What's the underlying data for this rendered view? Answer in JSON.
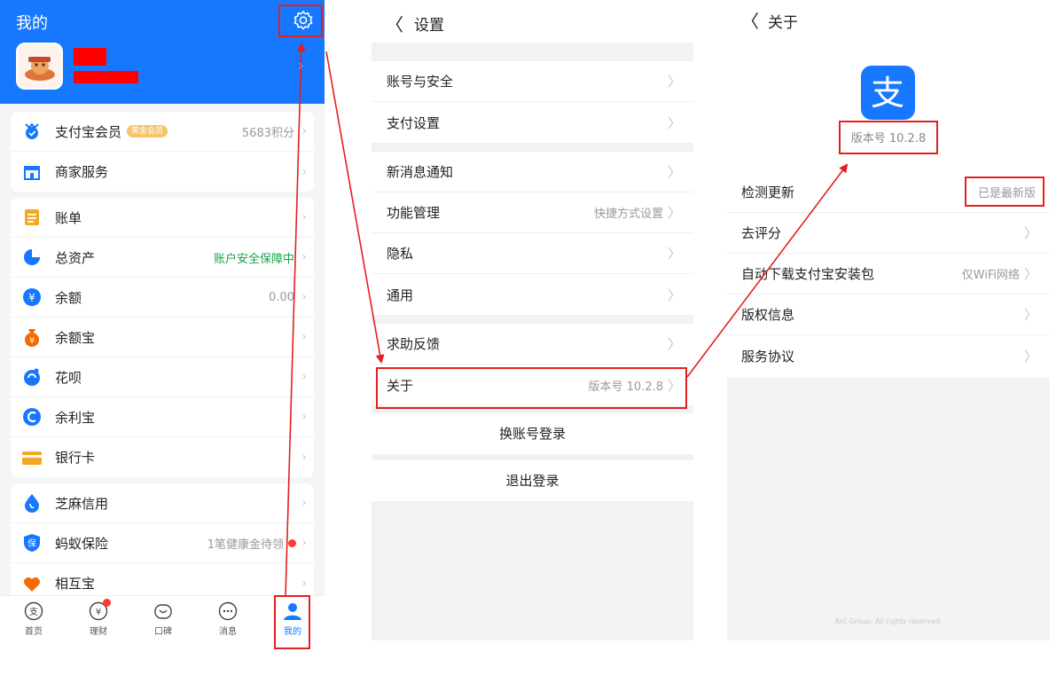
{
  "panel_mine": {
    "title": "我的",
    "items_group1": [
      {
        "label": "支付宝会员",
        "badge": "黄金会员",
        "value": "5683积分",
        "icon": "member-icon",
        "color": "#1677ff"
      },
      {
        "label": "商家服务",
        "value": "",
        "icon": "shop-icon",
        "color": "#1677ff"
      }
    ],
    "items_group2": [
      {
        "label": "账单",
        "value": "",
        "icon": "bill-icon",
        "color": "#f5a623"
      },
      {
        "label": "总资产",
        "value": "账户安全保障中",
        "icon": "pie-icon",
        "color": "#1677ff"
      },
      {
        "label": "余额",
        "value": "0.00",
        "icon": "yuan-icon",
        "color": "#1677ff"
      },
      {
        "label": "余额宝",
        "value": "",
        "icon": "bag-icon",
        "color": "#f56a00"
      },
      {
        "label": "花呗",
        "value": "",
        "icon": "huabei-icon",
        "color": "#1677ff"
      },
      {
        "label": "余利宝",
        "value": "",
        "icon": "yulibao-icon",
        "color": "#1677ff"
      },
      {
        "label": "银行卡",
        "value": "",
        "icon": "card-icon",
        "color": "#f5a623"
      }
    ],
    "items_group3": [
      {
        "label": "芝麻信用",
        "value": "",
        "icon": "sesame-icon",
        "color": "#1677ff"
      },
      {
        "label": "蚂蚁保险",
        "value": "1笔健康金待领",
        "icon": "insurance-icon",
        "color": "#1677ff"
      },
      {
        "label": "相互宝",
        "value": "",
        "icon": "heart-icon",
        "color": "#f56a00"
      }
    ],
    "tabs": [
      {
        "label": "首页",
        "icon": "home-icon"
      },
      {
        "label": "理财",
        "icon": "finance-icon"
      },
      {
        "label": "口碑",
        "icon": "koubei-icon"
      },
      {
        "label": "消息",
        "icon": "message-icon"
      },
      {
        "label": "我的",
        "icon": "person-icon"
      }
    ]
  },
  "panel_settings": {
    "back": "〈",
    "title": "设置",
    "groups": [
      [
        {
          "label": "账号与安全",
          "value": ""
        },
        {
          "label": "支付设置",
          "value": ""
        }
      ],
      [
        {
          "label": "新消息通知",
          "value": ""
        },
        {
          "label": "功能管理",
          "value": "快捷方式设置"
        },
        {
          "label": "隐私",
          "value": ""
        },
        {
          "label": "通用",
          "value": ""
        }
      ],
      [
        {
          "label": "求助反馈",
          "value": ""
        },
        {
          "label": "关于",
          "value": "版本号 10.2.8"
        }
      ]
    ],
    "switch_account": "换账号登录",
    "logout": "退出登录"
  },
  "panel_about": {
    "back": "〈",
    "title": "关于",
    "logo_glyph": "支",
    "version": "版本号 10.2.8",
    "rows": [
      {
        "label": "检测更新",
        "value": "已是最新版",
        "chevron": false
      },
      {
        "label": "去评分",
        "value": "",
        "chevron": true
      },
      {
        "label": "自动下载支付宝安装包",
        "value": "仅WiFi网络",
        "chevron": true
      },
      {
        "label": "版权信息",
        "value": "",
        "chevron": true
      },
      {
        "label": "服务协议",
        "value": "",
        "chevron": true
      }
    ],
    "copyright": "Ant Group. All rights reserved."
  },
  "colors": {
    "brand": "#1677ff",
    "annotation": "#e41f1f"
  }
}
